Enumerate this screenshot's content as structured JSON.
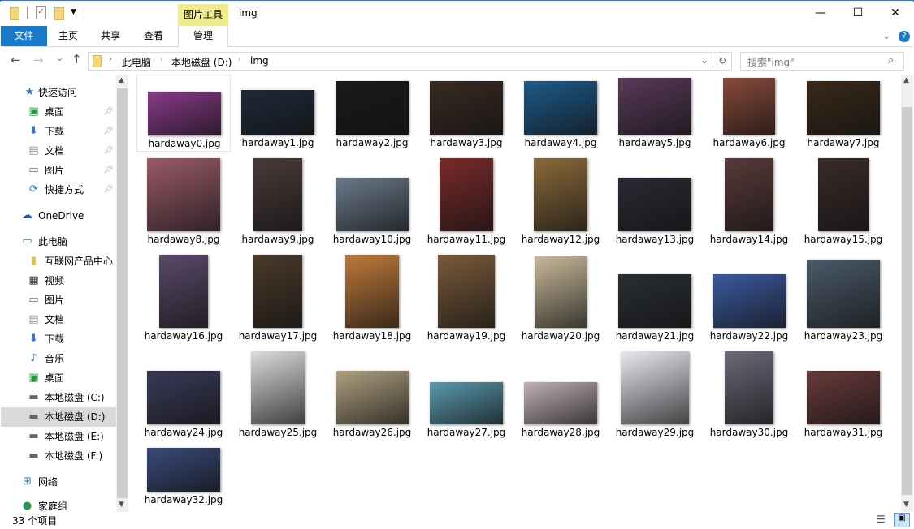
{
  "window": {
    "title": "img",
    "contextual_tab_group": "图片工具",
    "minimize": "—",
    "maximize": "☐",
    "close": "✕"
  },
  "ribbon": {
    "tabs": [
      "文件",
      "主页",
      "共享",
      "查看",
      "管理"
    ],
    "collapse": "⌄",
    "help": "?"
  },
  "address": {
    "crumbs": [
      "此电脑",
      "本地磁盘 (D:)",
      "img"
    ],
    "search_placeholder": "搜索\"img\"",
    "refresh": "↻",
    "dropdown": "⌄",
    "back": "←",
    "forward": "→",
    "recent": "⌄",
    "up": "↑"
  },
  "sidebar": {
    "quick_access": {
      "label": "快速访问",
      "items": [
        {
          "label": "桌面",
          "icon": "desktop-icon"
        },
        {
          "label": "下载",
          "icon": "download-icon"
        },
        {
          "label": "文档",
          "icon": "document-icon"
        },
        {
          "label": "图片",
          "icon": "picture-icon"
        },
        {
          "label": "快捷方式",
          "icon": "shortcut-icon"
        }
      ]
    },
    "onedrive": "OneDrive",
    "this_pc": {
      "label": "此电脑",
      "items": [
        {
          "label": "互联网产品中心",
          "icon": "network-folder-icon"
        },
        {
          "label": "视频",
          "icon": "video-icon"
        },
        {
          "label": "图片",
          "icon": "picture-icon"
        },
        {
          "label": "文档",
          "icon": "document-icon"
        },
        {
          "label": "下载",
          "icon": "download-icon"
        },
        {
          "label": "音乐",
          "icon": "music-icon"
        },
        {
          "label": "桌面",
          "icon": "desktop-icon"
        },
        {
          "label": "本地磁盘 (C:)",
          "icon": "drive-icon"
        },
        {
          "label": "本地磁盘 (D:)",
          "icon": "drive-icon",
          "selected": true
        },
        {
          "label": "本地磁盘 (E:)",
          "icon": "drive-icon"
        },
        {
          "label": "本地磁盘 (F:)",
          "icon": "drive-icon"
        }
      ]
    },
    "network": "网络",
    "homegroup": "家庭组"
  },
  "files": [
    {
      "name": "hardaway0.jpg",
      "color": "#8a3a8a"
    },
    {
      "name": "hardaway1.jpg",
      "color": "#1e2a3a"
    },
    {
      "name": "hardaway2.jpg",
      "color": "#1a1a1a"
    },
    {
      "name": "hardaway3.jpg",
      "color": "#3a2a22"
    },
    {
      "name": "hardaway4.jpg",
      "color": "#1d5a8a"
    },
    {
      "name": "hardaway5.jpg",
      "color": "#5a3a5a"
    },
    {
      "name": "hardaway6.jpg",
      "color": "#8a4a3a"
    },
    {
      "name": "hardaway7.jpg",
      "color": "#3a2a1a"
    },
    {
      "name": "hardaway8.jpg",
      "color": "#9a5a6a"
    },
    {
      "name": "hardaway9.jpg",
      "color": "#4a3a3a"
    },
    {
      "name": "hardaway10.jpg",
      "color": "#6a7a8a"
    },
    {
      "name": "hardaway11.jpg",
      "color": "#7a2a2a"
    },
    {
      "name": "hardaway12.jpg",
      "color": "#8a6a3a"
    },
    {
      "name": "hardaway13.jpg",
      "color": "#2a2a34"
    },
    {
      "name": "hardaway14.jpg",
      "color": "#5a3a3a"
    },
    {
      "name": "hardaway15.jpg",
      "color": "#3a2a2a"
    },
    {
      "name": "hardaway16.jpg",
      "color": "#5a4a6a"
    },
    {
      "name": "hardaway17.jpg",
      "color": "#4a3a2a"
    },
    {
      "name": "hardaway18.jpg",
      "color": "#c07a3a"
    },
    {
      "name": "hardaway19.jpg",
      "color": "#7a5a3a"
    },
    {
      "name": "hardaway20.jpg",
      "color": "#c8b89a"
    },
    {
      "name": "hardaway21.jpg",
      "color": "#2a2e34"
    },
    {
      "name": "hardaway22.jpg",
      "color": "#3a5aa0"
    },
    {
      "name": "hardaway23.jpg",
      "color": "#4a5a6a"
    },
    {
      "name": "hardaway24.jpg",
      "color": "#3a3a5a"
    },
    {
      "name": "hardaway25.jpg",
      "color": "#dcdcdc"
    },
    {
      "name": "hardaway26.jpg",
      "color": "#b0a080"
    },
    {
      "name": "hardaway27.jpg",
      "color": "#5a9ab0"
    },
    {
      "name": "hardaway28.jpg",
      "color": "#c0b0b8"
    },
    {
      "name": "hardaway29.jpg",
      "color": "#e8e8f0"
    },
    {
      "name": "hardaway30.jpg",
      "color": "#6a6a7a"
    },
    {
      "name": "hardaway31.jpg",
      "color": "#6a3a3a"
    },
    {
      "name": "hardaway32.jpg",
      "color": "#3a4a7a"
    }
  ],
  "status": {
    "count": "33 个项目"
  },
  "accent": "#1979ca"
}
